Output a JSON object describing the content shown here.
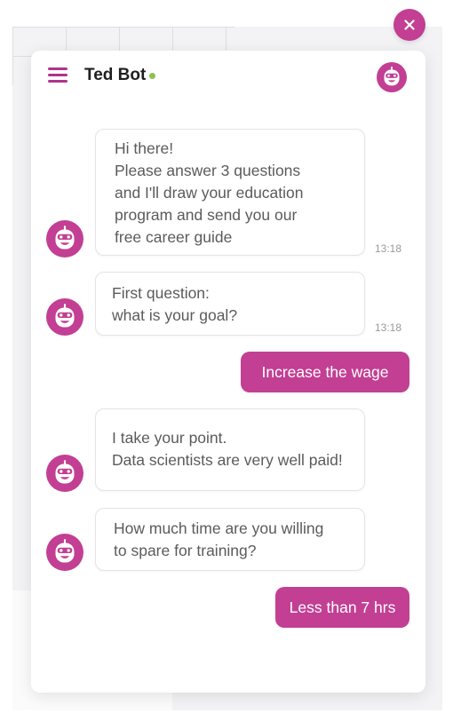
{
  "colors": {
    "accent": "#c23f93",
    "online": "#8cc152",
    "bubble_border": "#e4e4e8",
    "text_muted": "#5b5b5b"
  },
  "header": {
    "bot_name": "Ted Bot",
    "status": "online",
    "menu_icon": "hamburger-menu-icon",
    "avatar_icon": "robot-icon"
  },
  "close_icon": "close-icon",
  "messages": [
    {
      "from": "bot",
      "lines": [
        "Hi there!",
        "Please answer 3 questions",
        "and I'll draw your education",
        "program and send you our",
        "free career guide"
      ],
      "time": "13:18"
    },
    {
      "from": "bot",
      "lines": [
        "First question:",
        "what is your goal?"
      ],
      "time": "13:18"
    },
    {
      "from": "user",
      "text": "Increase the wage"
    },
    {
      "from": "bot",
      "lines": [
        "I take your point.",
        "Data scientists are very well paid!"
      ]
    },
    {
      "from": "bot",
      "lines": [
        "How much time are you willing",
        "to spare for training?"
      ]
    },
    {
      "from": "user",
      "text": "Less than 7 hrs"
    }
  ]
}
